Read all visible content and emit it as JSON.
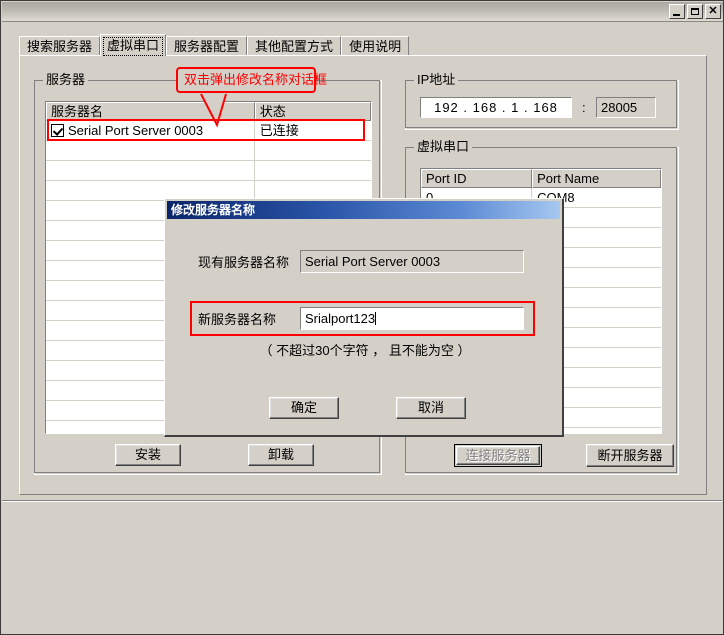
{
  "window": {
    "minimize_label": "Minimize",
    "maximize_label": "Maximize",
    "close_label": "Close"
  },
  "tabs": [
    {
      "label": "搜索服务器",
      "selected": false
    },
    {
      "label": "虚拟串口",
      "selected": true
    },
    {
      "label": "服务器配置",
      "selected": false
    },
    {
      "label": "其他配置方式",
      "selected": false
    },
    {
      "label": "使用说明",
      "selected": false
    }
  ],
  "server_group": {
    "title": "服务器",
    "columns": [
      "服务器名",
      "状态"
    ],
    "rows": [
      {
        "checked": true,
        "name": "Serial Port Server 0003",
        "status": "已连接"
      }
    ],
    "buttons": {
      "install": "安装",
      "uninstall": "卸载"
    }
  },
  "annotation": {
    "text": "双击弹出修改名称对话框",
    "color": "#ff0000"
  },
  "ip_group": {
    "title": "IP地址",
    "address": "192 . 168 .  1  . 168",
    "separator": ":",
    "port": "28005"
  },
  "vport_group": {
    "title": "虚拟串口",
    "columns": [
      "Port ID",
      "Port Name"
    ],
    "rows": [
      {
        "port_id": "0",
        "port_name": "COM8"
      }
    ],
    "buttons": {
      "connect": "连接服务器",
      "disconnect": "断开服务器"
    }
  },
  "dialog": {
    "title": "修改服务器名称",
    "existing_label": "现有服务器名称",
    "existing_value": "Serial Port Server 0003",
    "new_label": "新服务器名称",
    "new_value": "Srialport123",
    "hint": "（ 不超过30个字符 ， 且不能为空 ）",
    "ok_label": "确定",
    "cancel_label": "取消"
  }
}
